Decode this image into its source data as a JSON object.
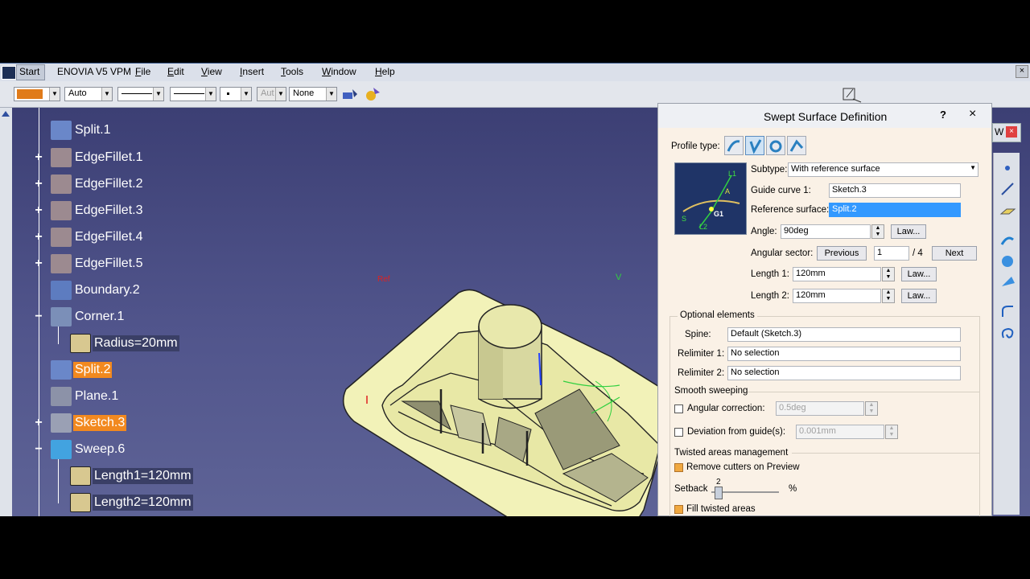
{
  "menubar": {
    "items": [
      "Start",
      "ENOVIA V5 VPM",
      "File",
      "Edit",
      "View",
      "Insert",
      "Tools",
      "Window",
      "Help"
    ]
  },
  "toolbar": {
    "color_swatch": "#e07b1a",
    "combo_linetype": "Auto",
    "combo_layer_disabled": "Aut",
    "combo_none": "None"
  },
  "tree": {
    "items": [
      {
        "label": "Split.1",
        "icon": "split-icon",
        "expand": ""
      },
      {
        "label": "EdgeFillet.1",
        "icon": "edgefillet-icon",
        "expand": "+"
      },
      {
        "label": "EdgeFillet.2",
        "icon": "edgefillet-icon",
        "expand": "+"
      },
      {
        "label": "EdgeFillet.3",
        "icon": "edgefillet-icon",
        "expand": "+"
      },
      {
        "label": "EdgeFillet.4",
        "icon": "edgefillet-icon",
        "expand": "+"
      },
      {
        "label": "EdgeFillet.5",
        "icon": "edgefillet-icon",
        "expand": "+"
      },
      {
        "label": "Boundary.2",
        "icon": "boundary-icon",
        "expand": ""
      },
      {
        "label": "Corner.1",
        "icon": "corner-icon",
        "expand": "−"
      },
      {
        "label": "Radius=20mm",
        "icon": "parameter-icon",
        "expand": ""
      },
      {
        "label": "Split.2",
        "icon": "split-icon",
        "expand": ""
      },
      {
        "label": "Plane.1",
        "icon": "plane-icon",
        "expand": ""
      },
      {
        "label": "Sketch.3",
        "icon": "sketch-icon",
        "expand": "+"
      },
      {
        "label": "Sweep.6",
        "icon": "sweep-icon",
        "expand": "−"
      },
      {
        "label": "Length1=120mm",
        "icon": "parameter-icon",
        "expand": ""
      },
      {
        "label": "Length2=120mm",
        "icon": "parameter-icon",
        "expand": ""
      }
    ]
  },
  "viewport": {
    "label_ref": "Ref",
    "label_v": "V"
  },
  "dialog": {
    "title": "Swept Surface Definition",
    "help": "?",
    "close": "×",
    "profile_type_label": "Profile type:",
    "subtype_label": "Subtype:",
    "subtype_value": "With reference surface",
    "guide_curve_label": "Guide curve 1:",
    "guide_curve_value": "Sketch.3",
    "reference_surface_label": "Reference surface:",
    "reference_surface_value": "Split.2",
    "angle_label": "Angle:",
    "angle_value": "90deg",
    "law_label": "Law...",
    "angular_sector_label": "Angular sector:",
    "previous_label": "Previous",
    "sector_value": "1",
    "sector_total": "/ 4",
    "next_label": "Next",
    "length1_label": "Length 1:",
    "length1_value": "120mm",
    "length2_label": "Length 2:",
    "length2_value": "120mm",
    "optional_elements_label": "Optional elements",
    "spine_label": "Spine:",
    "spine_value": "Default (Sketch.3)",
    "relimiter1_label": "Relimiter 1:",
    "relimiter1_value": "No selection",
    "relimiter2_label": "Relimiter 2:",
    "relimiter2_value": "No selection",
    "smooth_sweeping_label": "Smooth sweeping",
    "angular_correction_label": "Angular correction:",
    "angular_correction_value": "0.5deg",
    "deviation_label": "Deviation from guide(s):",
    "deviation_value": "0.001mm",
    "twisted_label": "Twisted areas management",
    "remove_cutters_label": "Remove cutters on Preview",
    "setback_label": "Setback",
    "setback_value": "2",
    "setback_unit": "%",
    "fill_twisted_label": "Fill twisted areas",
    "preview_labels": {
      "l1": "L1",
      "l2": "L2",
      "a": "A",
      "s": "S",
      "g1": "G1"
    }
  }
}
